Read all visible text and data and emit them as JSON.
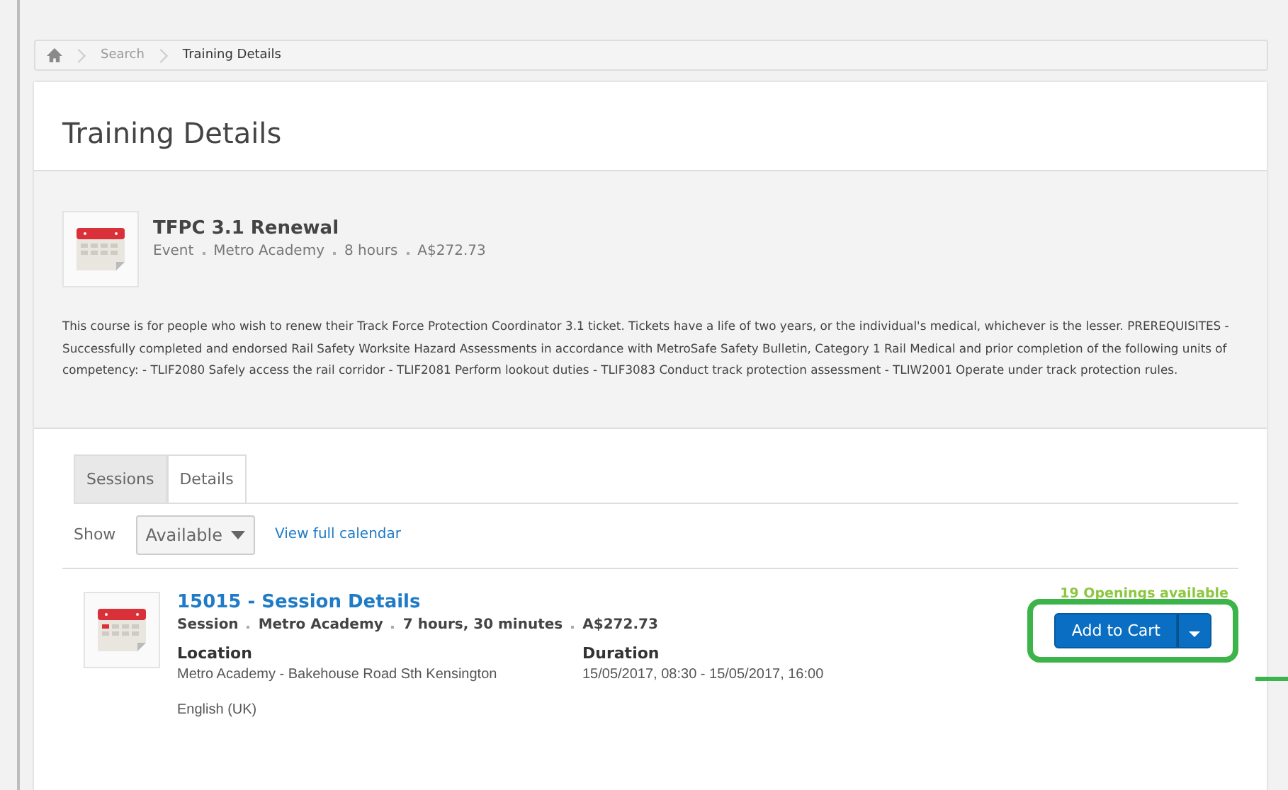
{
  "breadcrumb": [
    "Search",
    "Training Details"
  ],
  "title": "Training Details",
  "course": {
    "name": "TFPC 3.1 Renewal",
    "meta": [
      "Event",
      "Metro Academy",
      "8 hours",
      "A$272.73"
    ],
    "description": "This course is for people who wish to renew their Track Force Protection Coordinator 3.1 ticket. Tickets have a life of two years, or the individual's medical, whichever is the lesser. PREREQUISITES - Successfully completed and endorsed Rail Safety Worksite Hazard Assessments in accordance with MetroSafe Safety Bulletin, Category 1 Rail Medical and prior completion of the following units of competency: - TLIF2080 Safely access the rail corridor - TLIF2081 Perform lookout duties - TLIF3083 Conduct track protection assessment - TLIW2001 Operate under track protection rules."
  },
  "tabs": [
    {
      "label": "Sessions",
      "selected": true
    },
    {
      "label": "Details",
      "selected": false
    }
  ],
  "filter": {
    "label": "Show",
    "value": "Available",
    "link": "View full calendar"
  },
  "session": {
    "title": "15015 - Session Details",
    "meta": [
      "Session",
      "Metro Academy",
      "7 hours, 30 minutes",
      "A$272.73"
    ],
    "location_label": "Location",
    "location": "Metro Academy - Bakehouse Road Sth Kensington",
    "language": "English (UK)",
    "duration_label": "Duration",
    "duration": "15/05/2017, 08:30 - 15/05/2017, 16:00",
    "openings": "19 Openings available",
    "button": "Add to Cart",
    "highlighted": true
  }
}
